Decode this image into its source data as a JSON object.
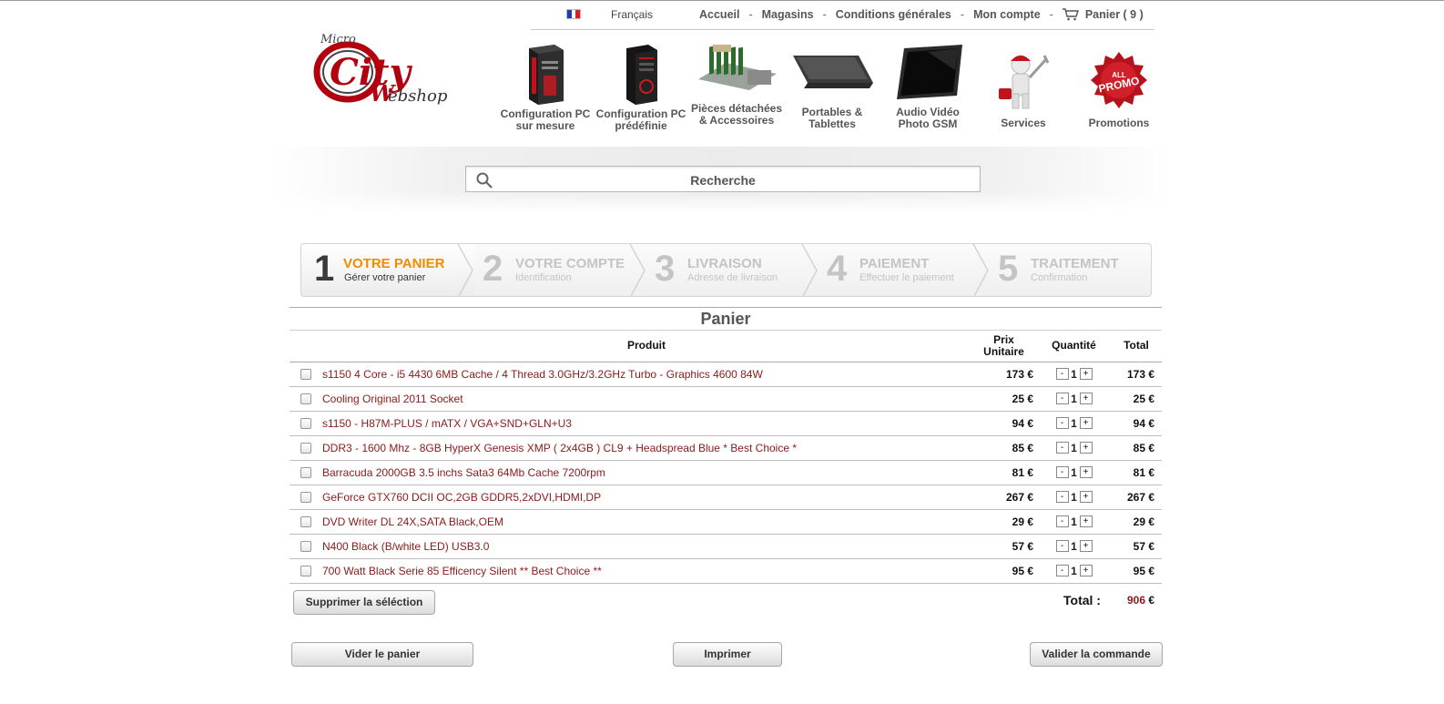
{
  "topbar": {
    "language": "Français",
    "links": [
      "Accueil",
      "Magasins",
      "Conditions générales",
      "Mon compte"
    ],
    "cart_label": "Panier ( 9 )",
    "flag_colors": [
      "#1f3fa8",
      "#ffffff",
      "#d8202a"
    ]
  },
  "logo": {
    "brand": "City Webshop"
  },
  "categories": [
    {
      "label": "Configuration PC sur mesure",
      "icon": "pc-tower-red-icon"
    },
    {
      "label": "Configuration PC prédéfinie",
      "icon": "pc-tower-black-icon"
    },
    {
      "label": "Pièces détachées & Accessoires",
      "icon": "ram-modules-icon"
    },
    {
      "label": "Portables & Tablettes",
      "icon": "laptop-icon"
    },
    {
      "label": "Audio Vidéo Photo GSM",
      "icon": "tv-screen-icon"
    },
    {
      "label": "Services",
      "icon": "technician-icon"
    },
    {
      "label": "Promotions",
      "icon": "promo-badge-icon"
    }
  ],
  "search": {
    "placeholder": "Recherche"
  },
  "steps": [
    {
      "num": "1",
      "title": "VOTRE PANIER",
      "sub": "Gérer votre panier",
      "active": true
    },
    {
      "num": "2",
      "title": "VOTRE COMPTE",
      "sub": "Identification",
      "active": false
    },
    {
      "num": "3",
      "title": "LIVRAISON",
      "sub": "Adresse de livraison",
      "active": false
    },
    {
      "num": "4",
      "title": "PAIEMENT",
      "sub": "Effectuer le paiement",
      "active": false
    },
    {
      "num": "5",
      "title": "TRAITEMENT",
      "sub": "Confirmation",
      "active": false
    }
  ],
  "cart": {
    "title": "Panier",
    "headers": {
      "product": "Produit",
      "unit_price": "Prix Unitaire",
      "quantity": "Quantité",
      "total": "Total"
    },
    "rows": [
      {
        "product": "s1150 4 Core - i5 4430 6MB Cache / 4 Thread 3.0GHz/3.2GHz Turbo - Graphics 4600 84W",
        "price": "173 €",
        "qty": "1",
        "total": "173 €"
      },
      {
        "product": "Cooling Original 2011 Socket",
        "price": "25 €",
        "qty": "1",
        "total": "25 €"
      },
      {
        "product": "s1150 - H87M-PLUS / mATX / VGA+SND+GLN+U3",
        "price": "94 €",
        "qty": "1",
        "total": "94 €"
      },
      {
        "product": "DDR3 - 1600 Mhz - 8GB HyperX Genesis XMP ( 2x4GB ) CL9 + Headspread Blue * Best Choice *",
        "price": "85 €",
        "qty": "1",
        "total": "85 €"
      },
      {
        "product": "Barracuda 2000GB 3.5 inchs Sata3 64Mb Cache 7200rpm",
        "price": "81 €",
        "qty": "1",
        "total": "81 €"
      },
      {
        "product": "GeForce GTX760 DCII OC,2GB GDDR5,2xDVI,HDMI,DP",
        "price": "267 €",
        "qty": "1",
        "total": "267 €"
      },
      {
        "product": "DVD Writer DL 24X,SATA Black,OEM",
        "price": "29 €",
        "qty": "1",
        "total": "29 €"
      },
      {
        "product": "N400 Black (B/white LED) USB3.0",
        "price": "57 €",
        "qty": "1",
        "total": "57 €"
      },
      {
        "product": "700 Watt Black Serie 85 Efficency Silent ** Best Choice **",
        "price": "95 €",
        "qty": "1",
        "total": "95 €"
      }
    ],
    "delete_selection": "Supprimer la séléction",
    "total_label": "Total :",
    "total_value": "906",
    "total_currency": "€"
  },
  "actions": {
    "empty": "Vider le panier",
    "print": "Imprimer",
    "validate": "Valider la commande"
  },
  "colors": {
    "accent_orange": "#f08c00",
    "product_red": "#8a1a1a"
  }
}
